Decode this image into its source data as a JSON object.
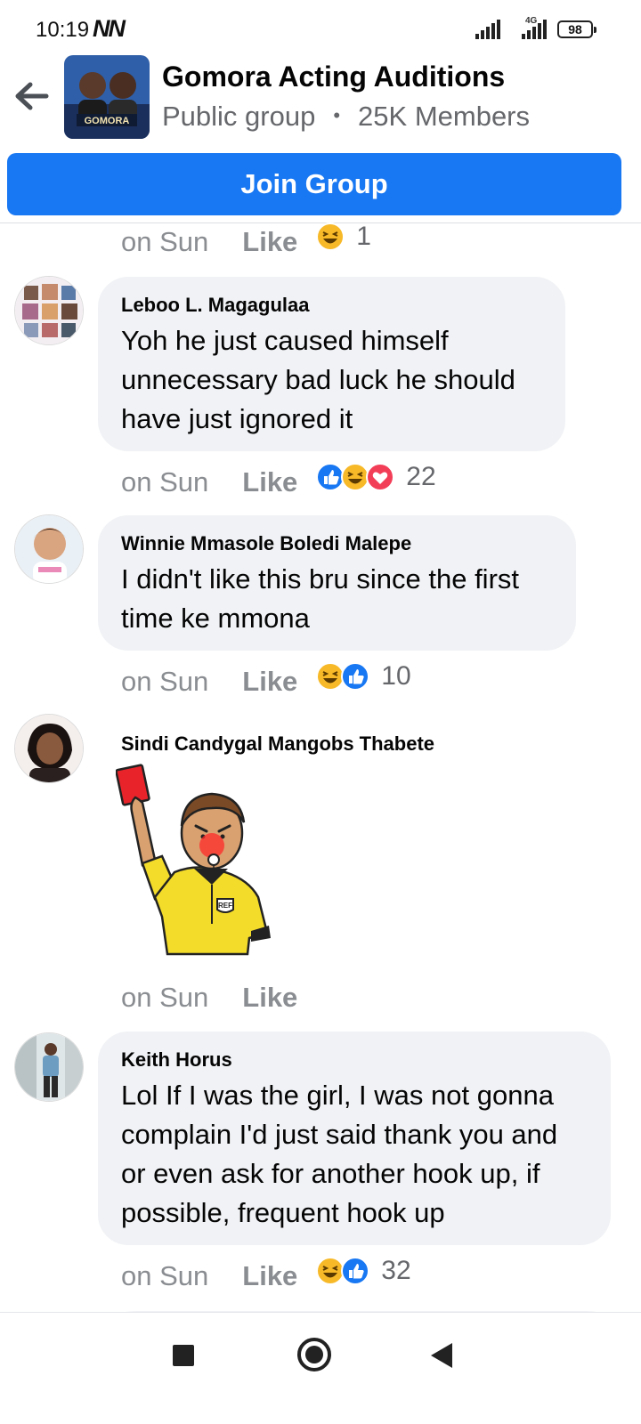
{
  "status_bar": {
    "time": "10:19",
    "carrier_icons": "NN",
    "network": "4G",
    "battery": "98"
  },
  "group": {
    "title": "Gomora Acting Auditions",
    "privacy": "Public group",
    "members": "25K Members",
    "join_label": "Join Group",
    "avatar_caption": "GOMORA"
  },
  "comments": [
    {
      "time": "on Sun",
      "like_label": "Like",
      "reactions": [
        "haha"
      ],
      "reaction_count": "1"
    },
    {
      "author": "Leboo L. Magagulaa",
      "text": "Yoh he just caused himself unnecessary bad luck he should have just ignored it",
      "time": "on Sun",
      "like_label": "Like",
      "reactions": [
        "like",
        "haha",
        "love"
      ],
      "reaction_count": "22"
    },
    {
      "author": "Winnie Mmasole Boledi Malepe",
      "text": "I didn't like this bru since the first time ke mmona",
      "time": "on Sun",
      "like_label": "Like",
      "reactions": [
        "haha",
        "like"
      ],
      "reaction_count": "10"
    },
    {
      "author": "Sindi Candygal Mangobs Thabete",
      "sticker": "referee-red-card-sticker",
      "sticker_badge": "REF",
      "time": "on Sun",
      "like_label": "Like"
    },
    {
      "author": "Keith Horus",
      "text": "Lol If I was the girl, I was not gonna complain I'd just said thank you and or even ask for another hook up, if possible, frequent hook up",
      "time": "on Sun",
      "like_label": "Like",
      "reactions": [
        "haha",
        "like"
      ],
      "reaction_count": "32"
    }
  ],
  "colors": {
    "primary": "#1877f2",
    "bubble": "#f0f2f5",
    "muted": "#8a8d91"
  },
  "nav_bar": {
    "recents_icon": "square-icon",
    "home_icon": "circle-icon",
    "back_icon": "triangle-back-icon"
  }
}
